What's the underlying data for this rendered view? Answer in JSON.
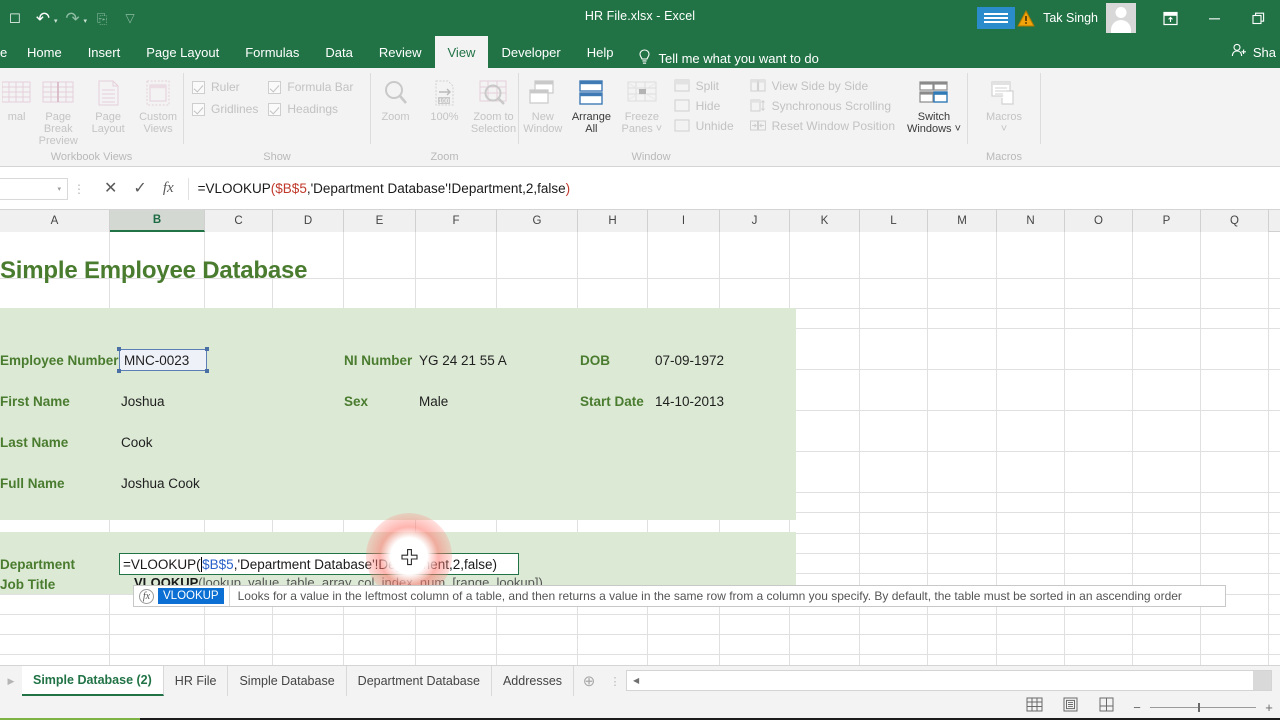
{
  "titlebar": {
    "document_title": "HR File.xlsx  -  Excel",
    "user_name": "Tak Singh",
    "qat": [
      {
        "name": "save",
        "glyph": "❙"
      },
      {
        "name": "undo",
        "glyph": "↶"
      },
      {
        "name": "redo",
        "glyph": "↷"
      },
      {
        "name": "print-preview",
        "glyph": "❐"
      },
      {
        "name": "customize-qat",
        "glyph": "⌄"
      }
    ],
    "window_controls": {
      "ribbon_display": "⬚",
      "minimize": "—",
      "restore": "❐"
    }
  },
  "ribbon_tabs": {
    "items": [
      "Home",
      "Insert",
      "Page Layout",
      "Formulas",
      "Data",
      "Review",
      "View",
      "Developer",
      "Help"
    ],
    "active": "View",
    "tell_me": "Tell me what you want to do",
    "share_label": "Sha"
  },
  "ribbon": {
    "groups": [
      {
        "title": "Workbook Views",
        "enabled": false,
        "buttons": [
          {
            "label": "mal",
            "icon": "normal-view-icon"
          },
          {
            "label": "Page Break\nPreview",
            "icon": "page-break-preview-icon"
          },
          {
            "label": "Page\nLayout",
            "icon": "page-layout-icon"
          },
          {
            "label": "Custom\nViews",
            "icon": "custom-views-icon"
          }
        ]
      },
      {
        "title": "Show",
        "enabled": false,
        "checkboxes": [
          {
            "label": "Ruler",
            "checked": true
          },
          {
            "label": "Formula Bar",
            "checked": true
          },
          {
            "label": "Gridlines",
            "checked": true
          },
          {
            "label": "Headings",
            "checked": true
          }
        ]
      },
      {
        "title": "Zoom",
        "enabled": false,
        "buttons": [
          {
            "label": "Zoom",
            "icon": "magnifier-icon"
          },
          {
            "label": "100%",
            "icon": "zoom-100-icon"
          },
          {
            "label": "Zoom to\nSelection",
            "icon": "zoom-to-selection-icon"
          }
        ]
      },
      {
        "title": "Window",
        "enabled": false,
        "buttons": [
          {
            "label": "New\nWindow",
            "icon": "new-window-icon",
            "on": false
          },
          {
            "label": "Arrange\nAll",
            "icon": "arrange-all-icon",
            "on": true
          },
          {
            "label": "Freeze\nPanes ˅",
            "icon": "freeze-panes-icon",
            "on": false
          }
        ],
        "small_items_a": [
          "Split",
          "Hide",
          "Unhide"
        ],
        "small_items_b": [
          "View Side by Side",
          "Synchronous Scrolling",
          "Reset Window Position"
        ]
      },
      {
        "title": "Macros",
        "enabled": false,
        "buttons": [
          {
            "label": "Switch\nWindows ˅",
            "icon": "switch-windows-icon",
            "on": true,
            "group": "Window"
          },
          {
            "label": "Macros\n˅",
            "icon": "macros-icon",
            "on": false
          }
        ]
      }
    ]
  },
  "formula_bar": {
    "name_box_value": "",
    "cancel_icon": "✕",
    "enter_icon": "✓",
    "fx_icon": "fx",
    "formula": {
      "full": "=VLOOKUP($B$5,'Department Database'!Department,2,false)",
      "tokens": [
        {
          "text": "=VLOOKUP",
          "color": "dark"
        },
        {
          "text": "(",
          "color": "red"
        },
        {
          "text": "$B$5",
          "color": "red"
        },
        {
          "text": ",'Department Database'!Department,2,false",
          "color": "dark"
        },
        {
          "text": ")",
          "color": "red"
        }
      ]
    }
  },
  "grid": {
    "columns": [
      "A",
      "B",
      "C",
      "D",
      "E",
      "F",
      "G",
      "H",
      "I",
      "J",
      "K",
      "L",
      "M",
      "N",
      "O",
      "P",
      "Q"
    ],
    "selected_column": "B",
    "sheet_title": "Simple Employee Database",
    "fields_left": [
      {
        "label": "Employee Number",
        "value": "MNC-0023",
        "selected": true
      },
      {
        "label": "First Name",
        "value": "Joshua",
        "selected": false
      },
      {
        "label": "Last Name",
        "value": "Cook",
        "selected": false
      },
      {
        "label": "Full Name",
        "value": "Joshua Cook",
        "selected": false
      }
    ],
    "fields_mid": [
      {
        "label": "NI Number",
        "value": "YG 24 21 55 A"
      },
      {
        "label": "Sex",
        "value": "Male"
      }
    ],
    "fields_right": [
      {
        "label": "DOB",
        "value": "07-09-1972"
      },
      {
        "label": "Start Date",
        "value": "14-10-2013"
      }
    ],
    "fields_lower": [
      {
        "label": "Department",
        "value": ""
      },
      {
        "label": "Job Title",
        "value": ""
      }
    ],
    "edit_cell": {
      "tokens": [
        {
          "text": "=VLOOKUP(",
          "color": "dark"
        },
        {
          "text": "$B$5",
          "color": "blue"
        },
        {
          "text": ",'Department Database'!Department,2,false)",
          "color": "dark"
        }
      ]
    },
    "signature_hint": {
      "name": "VLOOKUP",
      "args": "(lookup_value, table_array, col_index_num, [range_lookup])"
    },
    "tooltip": {
      "fx_icon": "fx",
      "function_name": "VLOOKUP",
      "description": "Looks for a value in the leftmost column of a table, and then returns a value in the same row from a column you specify. By default, the table must be sorted in an ascending order"
    }
  },
  "sheet_tabs": {
    "items": [
      "Simple Database (2)",
      "HR File",
      "Simple Database",
      "Department Database",
      "Addresses"
    ],
    "active": "Simple Database (2)",
    "add_sheet_glyph": "⊕",
    "prev_arrow": "▸",
    "scroll_left_arrow": "◀"
  },
  "status_bar": {
    "view_buttons": [
      {
        "name": "normal-view-button",
        "icon": "grid-icon"
      },
      {
        "name": "page-layout-view-button",
        "icon": "page-icon"
      },
      {
        "name": "page-break-preview-button",
        "icon": "pagebreak-icon"
      }
    ],
    "zoom_minus": "−",
    "zoom_plus": "+"
  },
  "colors": {
    "excel_green": "#217346",
    "title_green": "#4a7c2f",
    "block_green": "#dce9d5",
    "selection_blue": "#5b7fb4",
    "formula_red": "#c0392b",
    "ref_blue": "#2a62c9"
  }
}
